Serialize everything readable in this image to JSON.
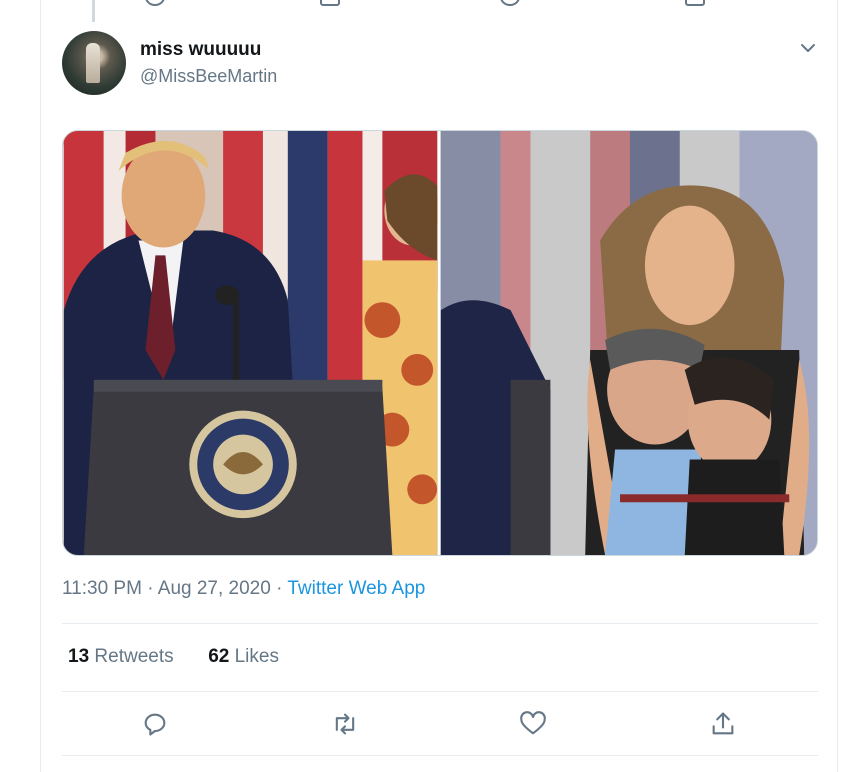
{
  "tweet": {
    "display_name": "miss wuuuuu",
    "handle": "@MissBeeMartin",
    "time": "11:30 PM",
    "date": "Aug 27, 2020",
    "source": "Twitter Web App",
    "retweet_count": "13",
    "retweet_label": "Retweets",
    "like_count": "62",
    "like_label": "Likes"
  },
  "icons": {
    "caret": "chevron-down-icon",
    "reply": "reply-icon",
    "retweet": "retweet-icon",
    "like": "heart-icon",
    "share": "share-icon"
  },
  "colors": {
    "link": "#1b95e0",
    "secondary_text": "#657786",
    "border": "#e6ecf0"
  },
  "media": {
    "left_photo": "photo-left",
    "right_photo": "photo-right"
  }
}
